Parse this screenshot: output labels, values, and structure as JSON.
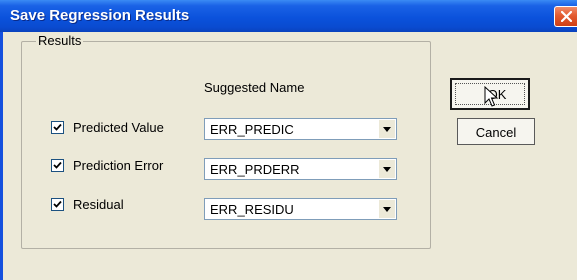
{
  "window": {
    "title": "Save Regression Results",
    "close_icon": "close-icon"
  },
  "group": {
    "title": "Results",
    "column_header": "Suggested Name"
  },
  "rows": [
    {
      "label": "Predicted Value",
      "checked": true,
      "value": "ERR_PREDIC"
    },
    {
      "label": "Prediction Error",
      "checked": true,
      "value": "ERR_PRDERR"
    },
    {
      "label": "Residual",
      "checked": true,
      "value": "ERR_RESIDU"
    }
  ],
  "buttons": {
    "ok": "OK",
    "cancel": "Cancel"
  },
  "colors": {
    "titlebar": "#0b52dc",
    "dialog_bg": "#ece9d8",
    "close": "#e35b30"
  }
}
